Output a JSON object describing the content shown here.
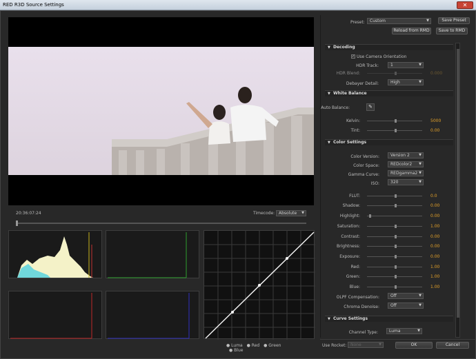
{
  "window": {
    "title": "RED R3D Source Settings",
    "close_glyph": "✕"
  },
  "preview": {
    "timecode": "20:36:07:24",
    "timecode_label": "Timecode:",
    "timecode_mode": "Absolute"
  },
  "curve_legend": {
    "items": [
      "Luma",
      "Red",
      "Green",
      "Blue"
    ]
  },
  "preset": {
    "label": "Preset:",
    "value": "Custom",
    "save_button": "Save Preset",
    "reload_button": "Reload from RMD",
    "save_rmd_button": "Save to RMD"
  },
  "decoding": {
    "title": "Decoding",
    "use_camera_orientation": "Use Camera Orientation",
    "hdr_track_label": "HDR Track:",
    "hdr_track_value": "1",
    "hdr_blend_label": "HDR Blend:",
    "hdr_blend_value": "0.000",
    "debayer_label": "Debayer Detail:",
    "debayer_value": "High"
  },
  "white_balance": {
    "title": "White Balance",
    "auto_label": "Auto Balance:",
    "kelvin_label": "Kelvin:",
    "kelvin_value": "5000",
    "tint_label": "Tint:",
    "tint_value": "0.00"
  },
  "color_settings": {
    "title": "Color Settings",
    "dropdowns": [
      {
        "label": "Color Version:",
        "value": "Version 2"
      },
      {
        "label": "Color Space:",
        "value": "REDcolor2"
      },
      {
        "label": "Gamma Curve:",
        "value": "REDgamma2"
      },
      {
        "label": "ISO:",
        "value": "320"
      }
    ],
    "sliders": [
      {
        "label": "FLUT:",
        "value": "0.0"
      },
      {
        "label": "Shadow:",
        "value": "0.00"
      },
      {
        "label": "Highlight:",
        "value": "0.00"
      },
      {
        "label": "Saturation:",
        "value": "1.00"
      },
      {
        "label": "Contrast:",
        "value": "0.00"
      },
      {
        "label": "Brightness:",
        "value": "0.00"
      },
      {
        "label": "Exposure:",
        "value": "0.00"
      },
      {
        "label": "Red:",
        "value": "1.00"
      },
      {
        "label": "Green:",
        "value": "1.00"
      },
      {
        "label": "Blue:",
        "value": "1.00"
      }
    ],
    "olpf_label": "OLPF Compensation:",
    "olpf_value": "Off",
    "chroma_label": "Chroma Denoise:",
    "chroma_value": "Off"
  },
  "curve_settings": {
    "title": "Curve Settings",
    "channel_label": "Channel Type:",
    "channel_value": "Luma"
  },
  "footer": {
    "rocket_label": "Use Rocket:",
    "rocket_value": "None",
    "ok_button": "OK",
    "cancel_button": "Cancel"
  },
  "colors": {
    "accent_value": "#e6a32a"
  }
}
